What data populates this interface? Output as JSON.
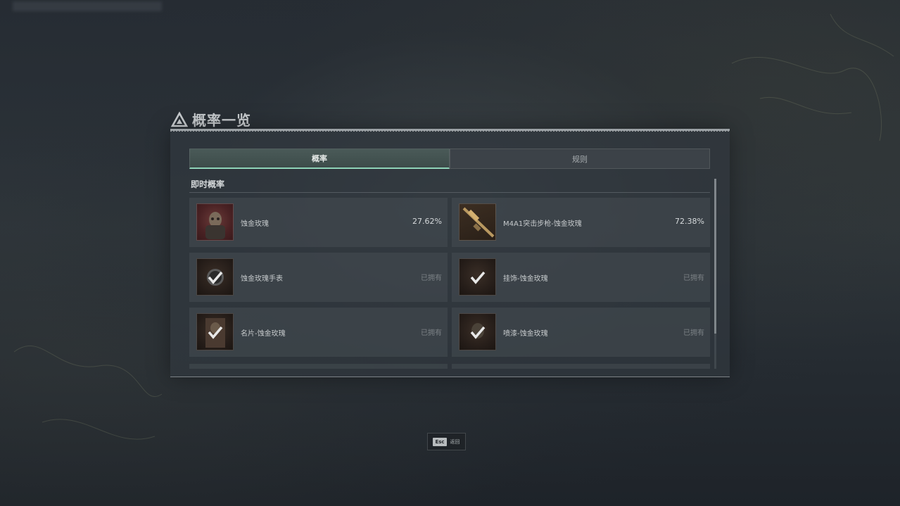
{
  "title": "概率一览",
  "tabs": [
    {
      "label": "概率",
      "active": true
    },
    {
      "label": "规则",
      "active": false
    }
  ],
  "section_title": "即时概率",
  "items": [
    {
      "name": "蚀金玫瑰",
      "value": "27.62%",
      "owned": false,
      "icon": "operator-skin-icon"
    },
    {
      "name": "M4A1突击步枪-蚀金玫瑰",
      "value": "72.38%",
      "owned": false,
      "icon": "rifle-icon"
    },
    {
      "name": "蚀金玫瑰手表",
      "value": "已拥有",
      "owned": true,
      "icon": "watch-icon"
    },
    {
      "name": "挂饰-蚀金玫瑰",
      "value": "已拥有",
      "owned": true,
      "icon": "charm-icon"
    },
    {
      "name": "名片-蚀金玫瑰",
      "value": "已拥有",
      "owned": true,
      "icon": "card-icon"
    },
    {
      "name": "喷漆-蚀金玫瑰",
      "value": "已拥有",
      "owned": true,
      "icon": "spray-icon"
    }
  ],
  "esc": {
    "key": "Esc",
    "label": "返回"
  },
  "colors": {
    "accent": "#8fd4b8",
    "panel": "#30373e",
    "text": "#c6cacc"
  }
}
